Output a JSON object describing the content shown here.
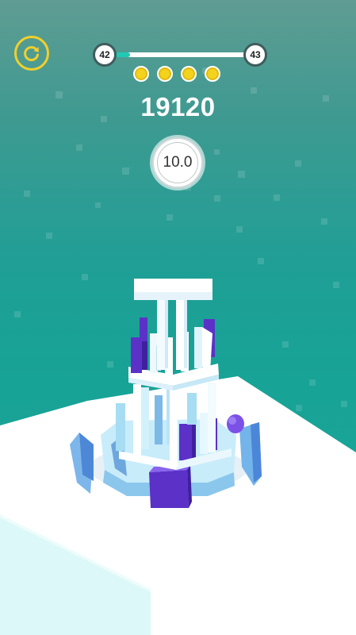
{
  "hud": {
    "current_level": "42",
    "next_level": "43",
    "level_progress": 0.16,
    "coins_collected": 4,
    "score": "19120",
    "timer": "10.0"
  },
  "colors": {
    "accent_yellow": "#f1cf2c",
    "progress_fill": "#20c9b4",
    "block_purple": "#6a3fd6",
    "tower_white": "#ffffff",
    "tower_blue": "#a9dff4"
  },
  "icons": {
    "restart": "restart-icon"
  }
}
